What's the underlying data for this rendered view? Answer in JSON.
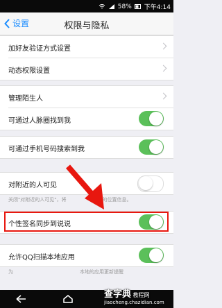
{
  "status_bar": {
    "battery": "58%",
    "time": "下午4:14",
    "icons": [
      "wifi-icon",
      "signal-icon",
      "battery-icon"
    ]
  },
  "nav": {
    "back_label": "设置",
    "title": "权限与隐私"
  },
  "group1": [
    {
      "label": "加好友验证方式设置"
    },
    {
      "label": "动态权限设置"
    }
  ],
  "group2": [
    {
      "label": "管理陌生人"
    },
    {
      "label": "可通过人脉圈找到我",
      "on": true
    }
  ],
  "group3": [
    {
      "label": "可通过手机号码搜索到我",
      "on": true
    }
  ],
  "group4": [
    {
      "label": "对附近的人可见",
      "on": false
    }
  ],
  "note_nearby": "关闭\"对附近的人可见\"，将",
  "note_nearby_tail": "的位置信息。",
  "group5": [
    {
      "label": "个性签名同步到说说",
      "on": true
    }
  ],
  "group6": [
    {
      "label": "允许QQ扫描本地应用",
      "on": true
    }
  ],
  "note_scan": "为",
  "note_scan_tail": "本地的应用更新提醒",
  "watermark": {
    "title": "查字典",
    "subtitle": "教程网",
    "url": "jiaocheng.chazidian.com"
  },
  "colors": {
    "accent": "#1a8cff",
    "toggle_on": "#5bc05a",
    "highlight": "#e8170f"
  }
}
